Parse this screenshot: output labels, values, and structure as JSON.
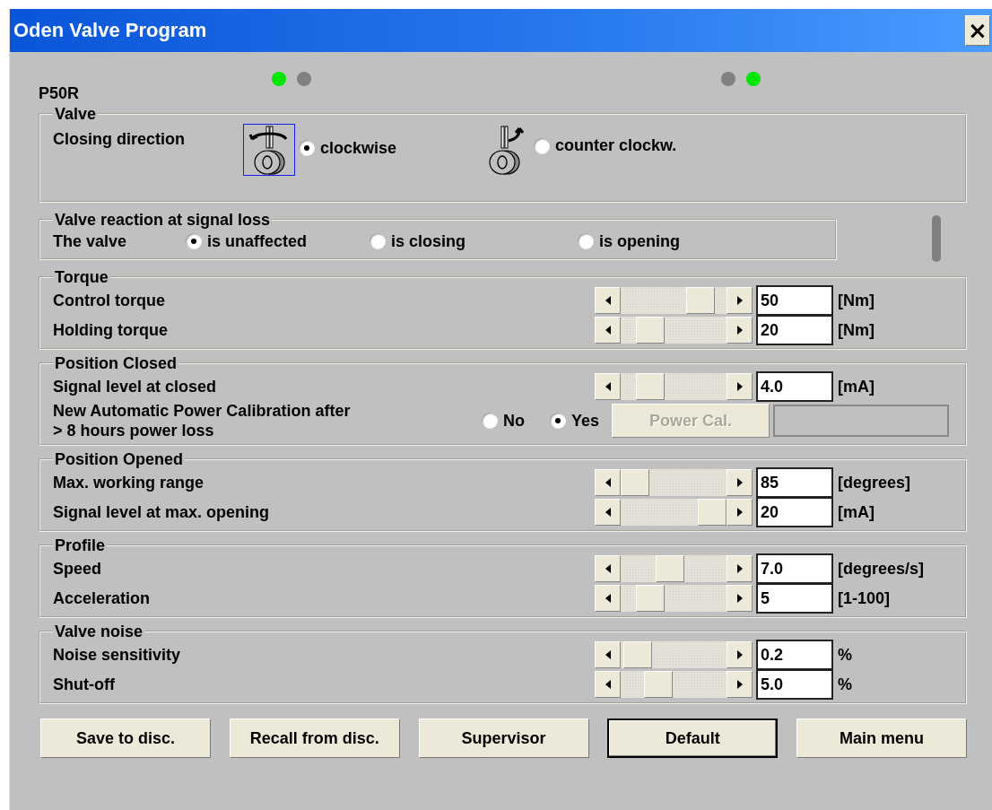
{
  "window": {
    "title": "Oden Valve Program",
    "close": "×"
  },
  "indicators_left": [
    {
      "color": "#00e600"
    },
    {
      "color": "#808080"
    }
  ],
  "indicators_right": [
    {
      "color": "#808080"
    },
    {
      "color": "#00e600"
    }
  ],
  "model": "P50R",
  "valve": {
    "title": "Valve",
    "label": "Closing direction",
    "options": [
      {
        "kind": "clockwise",
        "label": "clockwise",
        "selected": true
      },
      {
        "kind": "counter",
        "label": "counter clockw.",
        "selected": false
      }
    ]
  },
  "signal_loss": {
    "title": "Valve reaction at signal loss",
    "label": "The valve",
    "options": [
      {
        "label": "is unaffected",
        "selected": true
      },
      {
        "label": "is closing",
        "selected": false
      },
      {
        "label": "is opening",
        "selected": false
      }
    ]
  },
  "groups": [
    {
      "title": "Torque",
      "rows": [
        {
          "kind": "slider",
          "label": "Control torque",
          "level": 0.85,
          "value": "50",
          "unit": "[Nm]"
        },
        {
          "kind": "slider",
          "label": "Holding torque",
          "level": 0.2,
          "value": "20",
          "unit": "[Nm]"
        }
      ]
    },
    {
      "title": "Position Closed",
      "rows": [
        {
          "kind": "slider",
          "label": "Signal level at closed",
          "level": 0.2,
          "value": "4.0",
          "unit": "[mA]"
        },
        {
          "kind": "calibration",
          "label": "New Automatic Power Calibration after\n> 8 hours power loss",
          "options": [
            {
              "label": "No",
              "selected": false
            },
            {
              "label": "Yes",
              "selected": true
            }
          ],
          "button": "Power Cal.",
          "disabled": true
        }
      ]
    },
    {
      "title": "Position Opened",
      "rows": [
        {
          "kind": "slider",
          "label": "Max. working range",
          "level": 0,
          "value": "85",
          "unit": "[degrees]"
        },
        {
          "kind": "slider",
          "label": "Signal level at max. opening",
          "level": 1,
          "value": "20",
          "unit": "[mA]"
        }
      ]
    },
    {
      "title": "Profile",
      "rows": [
        {
          "kind": "slider",
          "label": "Speed",
          "level": 0.45,
          "value": "7.0",
          "unit": "[degrees/s]"
        },
        {
          "kind": "slider",
          "label": "Acceleration",
          "level": 0.2,
          "value": "5",
          "unit": "[1-100]"
        }
      ]
    },
    {
      "title": "Valve noise",
      "rows": [
        {
          "kind": "slider",
          "label": "Noise sensitivity",
          "level": 0.03,
          "value": "0.2",
          "unit": "%"
        },
        {
          "kind": "slider",
          "label": "Shut-off",
          "level": 0.3,
          "value": "5.0",
          "unit": "%"
        }
      ]
    }
  ],
  "buttons": [
    {
      "label": "Save to disc.",
      "default": false
    },
    {
      "label": "Recall from disc.",
      "default": false
    },
    {
      "label": "Supervisor",
      "default": false
    },
    {
      "label": "Default",
      "default": true
    },
    {
      "label": "Main menu",
      "default": false
    }
  ]
}
